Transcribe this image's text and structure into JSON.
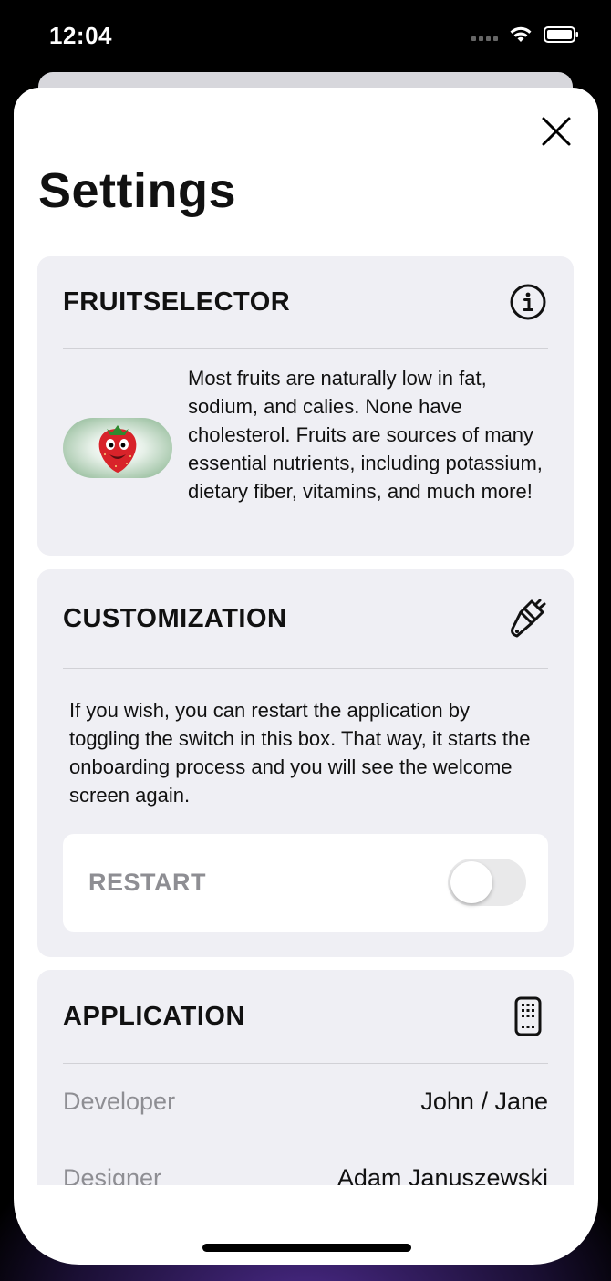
{
  "status_bar": {
    "time": "12:04"
  },
  "settings": {
    "title": "Settings"
  },
  "fruitselector": {
    "title": "FRUITSELECTOR",
    "icon": "info-circle-icon",
    "description": "Most fruits are naturally low in fat, sodium, and calies.  None have cholesterol.  Fruits are sources of many essential nutrients, including potassium, dietary fiber, vitamins, and much more!"
  },
  "customization": {
    "title": "CUSTOMIZATION",
    "icon": "paintbrush-icon",
    "description": "If you wish, you can restart the application by toggling the switch in this box.  That way, it starts the onboarding process and you will see the welcome screen again.",
    "restart_label": "RESTART",
    "restart_toggle_on": false
  },
  "application": {
    "title": "APPLICATION",
    "icon": "apps-iphone-icon",
    "rows": [
      {
        "label": "Developer",
        "value": "John / Jane"
      },
      {
        "label": "Designer",
        "value": "Adam Januszewski"
      }
    ]
  },
  "colors": {
    "group_background": "#efeff4",
    "toggle_off": "#e9e9ea",
    "secondary_text": "#8e8e93"
  }
}
